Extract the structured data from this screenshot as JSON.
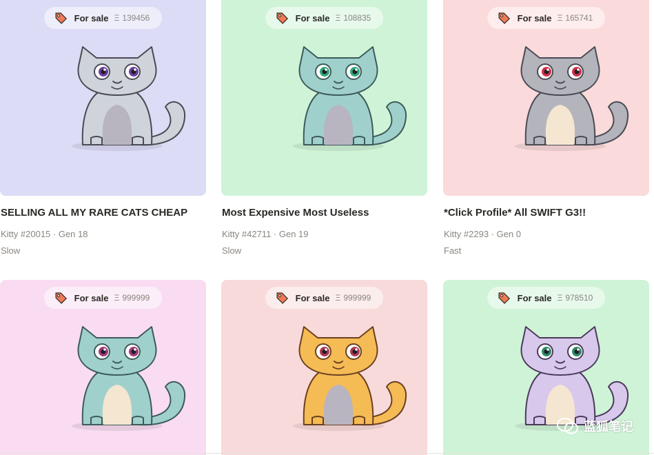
{
  "cards": [
    {
      "bg": "#dcdcf6",
      "sale_label": "For sale",
      "eth_symbol": "Ξ",
      "price": "139456",
      "title": "SELLING ALL MY RARE CATS CHEAP",
      "kitty": "Kitty #20015 · Gen 18",
      "speed": "Slow",
      "cat": {
        "body": "#cfd3da",
        "belly": "#b8b4c0",
        "eye": "#6b3fa0",
        "stroke": "#4a4a55"
      }
    },
    {
      "bg": "#cff3d7",
      "sale_label": "For sale",
      "eth_symbol": "Ξ",
      "price": "108835",
      "title": "Most Expensive Most Useless",
      "kitty": "Kitty #42711 · Gen 19",
      "speed": "Slow",
      "cat": {
        "body": "#9fd0cc",
        "belly": "#b8b4c0",
        "eye": "#2fa87a",
        "stroke": "#3d5a58"
      }
    },
    {
      "bg": "#fadada",
      "sale_label": "For sale",
      "eth_symbol": "Ξ",
      "price": "165741",
      "title": "*Click Profile* All SWIFT G3!!",
      "kitty": "Kitty #2293 · Gen 0",
      "speed": "Fast",
      "cat": {
        "body": "#b4b4bc",
        "belly": "#f4e6d0",
        "eye": "#d0304a",
        "stroke": "#4a4a55"
      }
    },
    {
      "bg": "#f9dcf1",
      "sale_label": "For sale",
      "eth_symbol": "Ξ",
      "price": "999999",
      "cat": {
        "body": "#9fd0cc",
        "belly": "#f4e6d0",
        "eye": "#a03a7a",
        "stroke": "#3d5a58"
      }
    },
    {
      "bg": "#f9dada",
      "sale_label": "For sale",
      "eth_symbol": "Ξ",
      "price": "999999",
      "cat": {
        "body": "#f5bb55",
        "belly": "#b8b4c0",
        "eye": "#b03a50",
        "stroke": "#6a4020"
      }
    },
    {
      "bg": "#cff3d7",
      "sale_label": "For sale",
      "eth_symbol": "Ξ",
      "price": "978510",
      "cat": {
        "body": "#d8c8ec",
        "belly": "#f4e6d0",
        "eye": "#2f8a6a",
        "stroke": "#4a3a5a"
      }
    }
  ],
  "watermark": {
    "text": "蓝狐笔记",
    "icon": "wechat-icon"
  },
  "colors": {
    "accent_tag": "#f07a55",
    "muted_text": "#8a8680",
    "title_text": "#2a2825"
  }
}
